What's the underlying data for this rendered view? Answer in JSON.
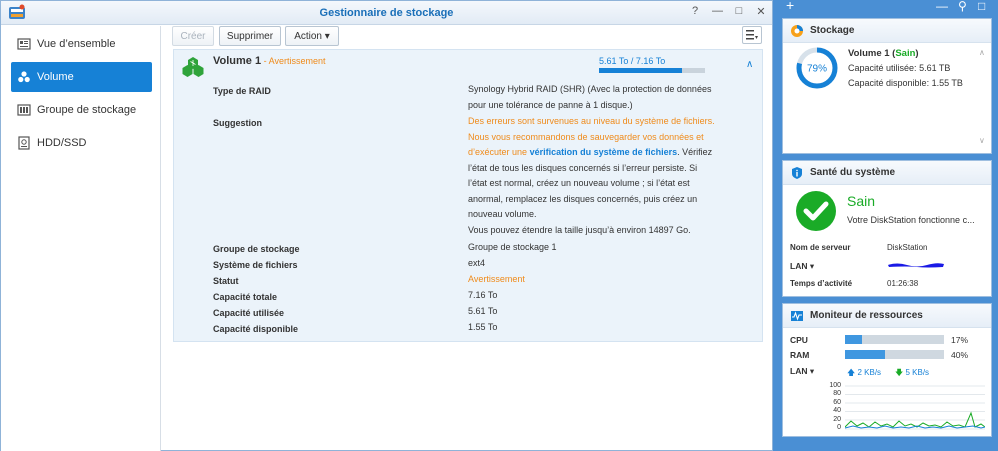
{
  "window": {
    "title": "Gestionnaire de stockage",
    "controls": [
      "?",
      "—",
      "□",
      "✕"
    ]
  },
  "sidebar": {
    "items": [
      {
        "label": "Vue d’ensemble"
      },
      {
        "label": "Volume"
      },
      {
        "label": "Groupe de stockage"
      },
      {
        "label": "HDD/SSD"
      }
    ]
  },
  "toolbar": {
    "create_label": "Créer",
    "delete_label": "Supprimer",
    "action_label": "Action ▾"
  },
  "volume": {
    "name": "Volume 1",
    "separator": " - ",
    "status": "Avertissement",
    "capacity_text": "5.61 To / 7.16 To",
    "used_fraction": 0.783,
    "rows": [
      {
        "label": "Type de RAID",
        "value": "Synology Hybrid RAID (SHR) (Avec la protection de données pour une tolérance de panne à 1 disque.)"
      },
      {
        "label": "Suggestion"
      },
      {
        "label": "Groupe de stockage",
        "value": "Groupe de stockage 1"
      },
      {
        "label": "Système de fichiers",
        "value": "ext4"
      },
      {
        "label": "Statut",
        "value": "Avertissement"
      },
      {
        "label": "Capacité totale",
        "value": "7.16 To"
      },
      {
        "label": "Capacité utilisée",
        "value": "5.61 To"
      },
      {
        "label": "Capacité disponible",
        "value": "1.55 To"
      }
    ],
    "suggestion": {
      "warning": "Des erreurs sont survenues au niveau du système de fichiers. Nous vous recommandons de sauvegarder vos données et d’exécuter une",
      "link": "vérification du système de fichiers",
      "rest": ". Vérifiez l’état de tous les disques concernés si l’erreur persiste. Si l’état est normal, créez un nouveau volume ; si l’état est anormal, remplacez les disques concernés, puis créez un nouveau volume.",
      "extend": "Vous pouvez étendre la taille jusqu’à environ 14897 Go."
    }
  },
  "taskbar": {
    "plus": "+",
    "minimize": "—",
    "pin": "⚲",
    "restore": "□"
  },
  "storage_widget": {
    "title": "Stockage",
    "percent": "79%",
    "percent_value": 79,
    "volume_name": "Volume 1",
    "volume_status": "Sain",
    "used_label": "Capacité utilisée",
    "used_value": "5.61 TB",
    "free_label": "Capacité disponible",
    "free_value": "1.55 TB",
    "ring_color": "#1681d6"
  },
  "health_widget": {
    "title": "Santé du système",
    "status": "Sain",
    "message": "Votre DiskStation fonctionne c...",
    "server_label": "Nom de serveur",
    "server_value": "DiskStation",
    "lan_label": "LAN ▾",
    "uptime_label": "Temps d’activité",
    "uptime_value": "01:26:38",
    "status_color": "#1aab27"
  },
  "monitor_widget": {
    "title": "Moniteur de ressources",
    "cpu_label": "CPU",
    "cpu_percent": "17%",
    "cpu_value": 17,
    "ram_label": "RAM",
    "ram_percent": "40%",
    "ram_value": 40,
    "lan_label": "LAN ▾",
    "upload": "2 KB/s",
    "download": "5 KB/s",
    "y_ticks": [
      "100",
      "80",
      "60",
      "40",
      "20",
      "0"
    ]
  }
}
